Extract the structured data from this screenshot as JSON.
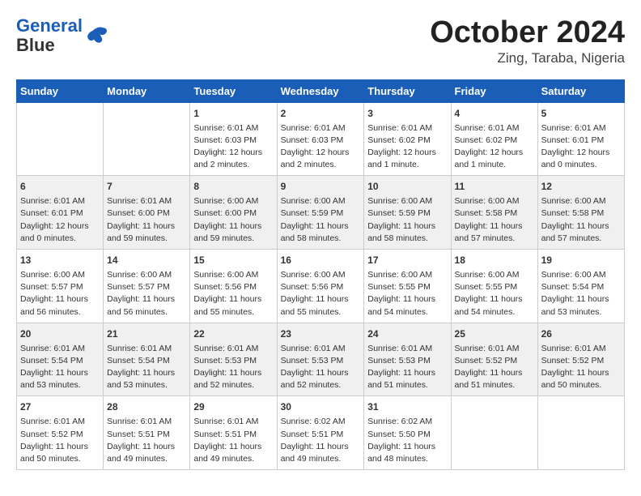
{
  "logo": {
    "line1": "General",
    "line2": "Blue"
  },
  "title": "October 2024",
  "location": "Zing, Taraba, Nigeria",
  "days_of_week": [
    "Sunday",
    "Monday",
    "Tuesday",
    "Wednesday",
    "Thursday",
    "Friday",
    "Saturday"
  ],
  "weeks": [
    [
      {
        "day": "",
        "info": ""
      },
      {
        "day": "",
        "info": ""
      },
      {
        "day": "1",
        "info": "Sunrise: 6:01 AM\nSunset: 6:03 PM\nDaylight: 12 hours and 2 minutes."
      },
      {
        "day": "2",
        "info": "Sunrise: 6:01 AM\nSunset: 6:03 PM\nDaylight: 12 hours and 2 minutes."
      },
      {
        "day": "3",
        "info": "Sunrise: 6:01 AM\nSunset: 6:02 PM\nDaylight: 12 hours and 1 minute."
      },
      {
        "day": "4",
        "info": "Sunrise: 6:01 AM\nSunset: 6:02 PM\nDaylight: 12 hours and 1 minute."
      },
      {
        "day": "5",
        "info": "Sunrise: 6:01 AM\nSunset: 6:01 PM\nDaylight: 12 hours and 0 minutes."
      }
    ],
    [
      {
        "day": "6",
        "info": "Sunrise: 6:01 AM\nSunset: 6:01 PM\nDaylight: 12 hours and 0 minutes."
      },
      {
        "day": "7",
        "info": "Sunrise: 6:01 AM\nSunset: 6:00 PM\nDaylight: 11 hours and 59 minutes."
      },
      {
        "day": "8",
        "info": "Sunrise: 6:00 AM\nSunset: 6:00 PM\nDaylight: 11 hours and 59 minutes."
      },
      {
        "day": "9",
        "info": "Sunrise: 6:00 AM\nSunset: 5:59 PM\nDaylight: 11 hours and 58 minutes."
      },
      {
        "day": "10",
        "info": "Sunrise: 6:00 AM\nSunset: 5:59 PM\nDaylight: 11 hours and 58 minutes."
      },
      {
        "day": "11",
        "info": "Sunrise: 6:00 AM\nSunset: 5:58 PM\nDaylight: 11 hours and 57 minutes."
      },
      {
        "day": "12",
        "info": "Sunrise: 6:00 AM\nSunset: 5:58 PM\nDaylight: 11 hours and 57 minutes."
      }
    ],
    [
      {
        "day": "13",
        "info": "Sunrise: 6:00 AM\nSunset: 5:57 PM\nDaylight: 11 hours and 56 minutes."
      },
      {
        "day": "14",
        "info": "Sunrise: 6:00 AM\nSunset: 5:57 PM\nDaylight: 11 hours and 56 minutes."
      },
      {
        "day": "15",
        "info": "Sunrise: 6:00 AM\nSunset: 5:56 PM\nDaylight: 11 hours and 55 minutes."
      },
      {
        "day": "16",
        "info": "Sunrise: 6:00 AM\nSunset: 5:56 PM\nDaylight: 11 hours and 55 minutes."
      },
      {
        "day": "17",
        "info": "Sunrise: 6:00 AM\nSunset: 5:55 PM\nDaylight: 11 hours and 54 minutes."
      },
      {
        "day": "18",
        "info": "Sunrise: 6:00 AM\nSunset: 5:55 PM\nDaylight: 11 hours and 54 minutes."
      },
      {
        "day": "19",
        "info": "Sunrise: 6:00 AM\nSunset: 5:54 PM\nDaylight: 11 hours and 53 minutes."
      }
    ],
    [
      {
        "day": "20",
        "info": "Sunrise: 6:01 AM\nSunset: 5:54 PM\nDaylight: 11 hours and 53 minutes."
      },
      {
        "day": "21",
        "info": "Sunrise: 6:01 AM\nSunset: 5:54 PM\nDaylight: 11 hours and 53 minutes."
      },
      {
        "day": "22",
        "info": "Sunrise: 6:01 AM\nSunset: 5:53 PM\nDaylight: 11 hours and 52 minutes."
      },
      {
        "day": "23",
        "info": "Sunrise: 6:01 AM\nSunset: 5:53 PM\nDaylight: 11 hours and 52 minutes."
      },
      {
        "day": "24",
        "info": "Sunrise: 6:01 AM\nSunset: 5:53 PM\nDaylight: 11 hours and 51 minutes."
      },
      {
        "day": "25",
        "info": "Sunrise: 6:01 AM\nSunset: 5:52 PM\nDaylight: 11 hours and 51 minutes."
      },
      {
        "day": "26",
        "info": "Sunrise: 6:01 AM\nSunset: 5:52 PM\nDaylight: 11 hours and 50 minutes."
      }
    ],
    [
      {
        "day": "27",
        "info": "Sunrise: 6:01 AM\nSunset: 5:52 PM\nDaylight: 11 hours and 50 minutes."
      },
      {
        "day": "28",
        "info": "Sunrise: 6:01 AM\nSunset: 5:51 PM\nDaylight: 11 hours and 49 minutes."
      },
      {
        "day": "29",
        "info": "Sunrise: 6:01 AM\nSunset: 5:51 PM\nDaylight: 11 hours and 49 minutes."
      },
      {
        "day": "30",
        "info": "Sunrise: 6:02 AM\nSunset: 5:51 PM\nDaylight: 11 hours and 49 minutes."
      },
      {
        "day": "31",
        "info": "Sunrise: 6:02 AM\nSunset: 5:50 PM\nDaylight: 11 hours and 48 minutes."
      },
      {
        "day": "",
        "info": ""
      },
      {
        "day": "",
        "info": ""
      }
    ]
  ]
}
